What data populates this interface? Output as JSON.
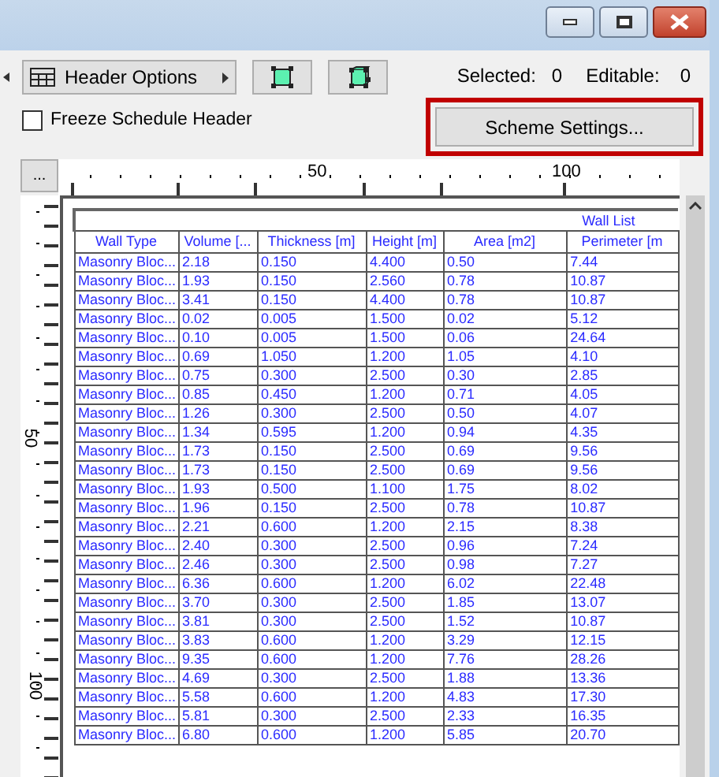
{
  "toolbar": {
    "header_options": "Header Options",
    "selected_label": "Selected:",
    "selected_value": "0",
    "editable_label": "Editable:",
    "editable_value": "0",
    "scheme_settings": {
      "label": "Scheme Settings...",
      "highlighted": true
    },
    "freeze_header": {
      "label": "Freeze Schedule Header",
      "checked": false
    },
    "more_button": "..."
  },
  "ruler": {
    "top_labels": [
      "50",
      "100"
    ],
    "side_labels": [
      "50",
      "100"
    ]
  },
  "table": {
    "title": "Wall List",
    "columns": [
      "Wall Type",
      "Volume [...",
      "Thickness [m]",
      "Height [m]",
      "Area [m2]",
      "Perimeter [m"
    ],
    "rows": [
      [
        "Masonry Bloc...",
        "2.18",
        "0.150",
        "4.400",
        "0.50",
        "7.44"
      ],
      [
        "Masonry Bloc...",
        "1.93",
        "0.150",
        "2.560",
        "0.78",
        "10.87"
      ],
      [
        "Masonry Bloc...",
        "3.41",
        "0.150",
        "4.400",
        "0.78",
        "10.87"
      ],
      [
        "Masonry Bloc...",
        "0.02",
        "0.005",
        "1.500",
        "0.02",
        "5.12"
      ],
      [
        "Masonry Bloc...",
        "0.10",
        "0.005",
        "1.500",
        "0.06",
        "24.64"
      ],
      [
        "Masonry Bloc...",
        "0.69",
        "1.050",
        "1.200",
        "1.05",
        "4.10"
      ],
      [
        "Masonry Bloc...",
        "0.75",
        "0.300",
        "2.500",
        "0.30",
        "2.85"
      ],
      [
        "Masonry Bloc...",
        "0.85",
        "0.450",
        "1.200",
        "0.71",
        "4.05"
      ],
      [
        "Masonry Bloc...",
        "1.26",
        "0.300",
        "2.500",
        "0.50",
        "4.07"
      ],
      [
        "Masonry Bloc...",
        "1.34",
        "0.595",
        "1.200",
        "0.94",
        "4.35"
      ],
      [
        "Masonry Bloc...",
        "1.73",
        "0.150",
        "2.500",
        "0.69",
        "9.56"
      ],
      [
        "Masonry Bloc...",
        "1.73",
        "0.150",
        "2.500",
        "0.69",
        "9.56"
      ],
      [
        "Masonry Bloc...",
        "1.93",
        "0.500",
        "1.100",
        "1.75",
        "8.02"
      ],
      [
        "Masonry Bloc...",
        "1.96",
        "0.150",
        "2.500",
        "0.78",
        "10.87"
      ],
      [
        "Masonry Bloc...",
        "2.21",
        "0.600",
        "1.200",
        "2.15",
        "8.38"
      ],
      [
        "Masonry Bloc...",
        "2.40",
        "0.300",
        "2.500",
        "0.96",
        "7.24"
      ],
      [
        "Masonry Bloc...",
        "2.46",
        "0.300",
        "2.500",
        "0.98",
        "7.27"
      ],
      [
        "Masonry Bloc...",
        "6.36",
        "0.600",
        "1.200",
        "6.02",
        "22.48"
      ],
      [
        "Masonry Bloc...",
        "3.70",
        "0.300",
        "2.500",
        "1.85",
        "13.07"
      ],
      [
        "Masonry Bloc...",
        "3.81",
        "0.300",
        "2.500",
        "1.52",
        "10.87"
      ],
      [
        "Masonry Bloc...",
        "3.83",
        "0.600",
        "1.200",
        "3.29",
        "12.15"
      ],
      [
        "Masonry Bloc...",
        "9.35",
        "0.600",
        "1.200",
        "7.76",
        "28.26"
      ],
      [
        "Masonry Bloc...",
        "4.69",
        "0.300",
        "2.500",
        "1.88",
        "13.36"
      ],
      [
        "Masonry Bloc...",
        "5.58",
        "0.600",
        "1.200",
        "4.83",
        "17.30"
      ],
      [
        "Masonry Bloc...",
        "5.81",
        "0.300",
        "2.500",
        "2.33",
        "16.35"
      ],
      [
        "Masonry Bloc...",
        "6.80",
        "0.600",
        "1.200",
        "5.85",
        "20.70"
      ]
    ]
  }
}
